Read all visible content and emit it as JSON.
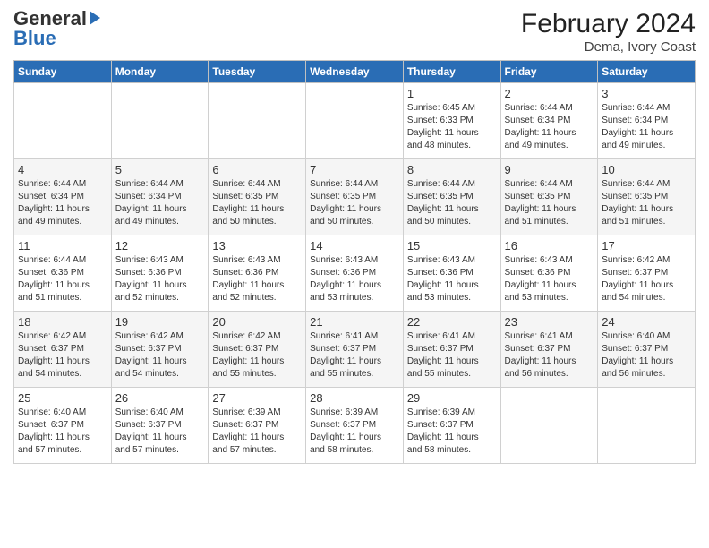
{
  "logo": {
    "general": "General",
    "blue": "Blue"
  },
  "title": "February 2024",
  "subtitle": "Dema, Ivory Coast",
  "days_of_week": [
    "Sunday",
    "Monday",
    "Tuesday",
    "Wednesday",
    "Thursday",
    "Friday",
    "Saturday"
  ],
  "weeks": [
    [
      {
        "day": "",
        "content": ""
      },
      {
        "day": "",
        "content": ""
      },
      {
        "day": "",
        "content": ""
      },
      {
        "day": "",
        "content": ""
      },
      {
        "day": "1",
        "content": "Sunrise: 6:45 AM\nSunset: 6:33 PM\nDaylight: 11 hours\nand 48 minutes."
      },
      {
        "day": "2",
        "content": "Sunrise: 6:44 AM\nSunset: 6:34 PM\nDaylight: 11 hours\nand 49 minutes."
      },
      {
        "day": "3",
        "content": "Sunrise: 6:44 AM\nSunset: 6:34 PM\nDaylight: 11 hours\nand 49 minutes."
      }
    ],
    [
      {
        "day": "4",
        "content": "Sunrise: 6:44 AM\nSunset: 6:34 PM\nDaylight: 11 hours\nand 49 minutes."
      },
      {
        "day": "5",
        "content": "Sunrise: 6:44 AM\nSunset: 6:34 PM\nDaylight: 11 hours\nand 49 minutes."
      },
      {
        "day": "6",
        "content": "Sunrise: 6:44 AM\nSunset: 6:35 PM\nDaylight: 11 hours\nand 50 minutes."
      },
      {
        "day": "7",
        "content": "Sunrise: 6:44 AM\nSunset: 6:35 PM\nDaylight: 11 hours\nand 50 minutes."
      },
      {
        "day": "8",
        "content": "Sunrise: 6:44 AM\nSunset: 6:35 PM\nDaylight: 11 hours\nand 50 minutes."
      },
      {
        "day": "9",
        "content": "Sunrise: 6:44 AM\nSunset: 6:35 PM\nDaylight: 11 hours\nand 51 minutes."
      },
      {
        "day": "10",
        "content": "Sunrise: 6:44 AM\nSunset: 6:35 PM\nDaylight: 11 hours\nand 51 minutes."
      }
    ],
    [
      {
        "day": "11",
        "content": "Sunrise: 6:44 AM\nSunset: 6:36 PM\nDaylight: 11 hours\nand 51 minutes."
      },
      {
        "day": "12",
        "content": "Sunrise: 6:43 AM\nSunset: 6:36 PM\nDaylight: 11 hours\nand 52 minutes."
      },
      {
        "day": "13",
        "content": "Sunrise: 6:43 AM\nSunset: 6:36 PM\nDaylight: 11 hours\nand 52 minutes."
      },
      {
        "day": "14",
        "content": "Sunrise: 6:43 AM\nSunset: 6:36 PM\nDaylight: 11 hours\nand 53 minutes."
      },
      {
        "day": "15",
        "content": "Sunrise: 6:43 AM\nSunset: 6:36 PM\nDaylight: 11 hours\nand 53 minutes."
      },
      {
        "day": "16",
        "content": "Sunrise: 6:43 AM\nSunset: 6:36 PM\nDaylight: 11 hours\nand 53 minutes."
      },
      {
        "day": "17",
        "content": "Sunrise: 6:42 AM\nSunset: 6:37 PM\nDaylight: 11 hours\nand 54 minutes."
      }
    ],
    [
      {
        "day": "18",
        "content": "Sunrise: 6:42 AM\nSunset: 6:37 PM\nDaylight: 11 hours\nand 54 minutes."
      },
      {
        "day": "19",
        "content": "Sunrise: 6:42 AM\nSunset: 6:37 PM\nDaylight: 11 hours\nand 54 minutes."
      },
      {
        "day": "20",
        "content": "Sunrise: 6:42 AM\nSunset: 6:37 PM\nDaylight: 11 hours\nand 55 minutes."
      },
      {
        "day": "21",
        "content": "Sunrise: 6:41 AM\nSunset: 6:37 PM\nDaylight: 11 hours\nand 55 minutes."
      },
      {
        "day": "22",
        "content": "Sunrise: 6:41 AM\nSunset: 6:37 PM\nDaylight: 11 hours\nand 55 minutes."
      },
      {
        "day": "23",
        "content": "Sunrise: 6:41 AM\nSunset: 6:37 PM\nDaylight: 11 hours\nand 56 minutes."
      },
      {
        "day": "24",
        "content": "Sunrise: 6:40 AM\nSunset: 6:37 PM\nDaylight: 11 hours\nand 56 minutes."
      }
    ],
    [
      {
        "day": "25",
        "content": "Sunrise: 6:40 AM\nSunset: 6:37 PM\nDaylight: 11 hours\nand 57 minutes."
      },
      {
        "day": "26",
        "content": "Sunrise: 6:40 AM\nSunset: 6:37 PM\nDaylight: 11 hours\nand 57 minutes."
      },
      {
        "day": "27",
        "content": "Sunrise: 6:39 AM\nSunset: 6:37 PM\nDaylight: 11 hours\nand 57 minutes."
      },
      {
        "day": "28",
        "content": "Sunrise: 6:39 AM\nSunset: 6:37 PM\nDaylight: 11 hours\nand 58 minutes."
      },
      {
        "day": "29",
        "content": "Sunrise: 6:39 AM\nSunset: 6:37 PM\nDaylight: 11 hours\nand 58 minutes."
      },
      {
        "day": "",
        "content": ""
      },
      {
        "day": "",
        "content": ""
      }
    ]
  ]
}
